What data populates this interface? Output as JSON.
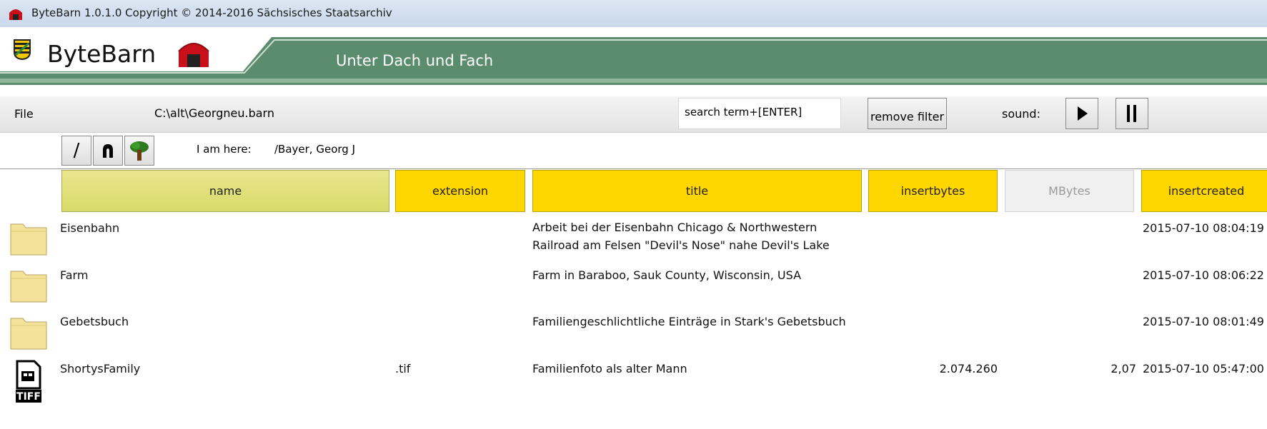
{
  "window": {
    "title": "ByteBarn 1.0.1.0    Copyright ©  2014-2016 Sächsisches Staatsarchiv"
  },
  "banner": {
    "brand": "ByteBarn",
    "motto": "Unter Dach und Fach",
    "colors": {
      "green": "#5b8c6e",
      "green_light": "#8fb59a",
      "barn_red": "#c8101a"
    },
    "icons": [
      "saxony-crest-icon",
      "barn-logo-icon"
    ]
  },
  "menubar": {
    "file_label": "File",
    "file_path": "C:\\alt\\Georgneu.barn",
    "search_placeholder": "search term+[ENTER]",
    "remove_filter_label": "remove filter",
    "sound_label": "sound:",
    "icons": [
      "play-icon",
      "pause-icon"
    ]
  },
  "nav": {
    "buttons": [
      {
        "label": "/",
        "icon": "root-slash-icon"
      },
      {
        "label": "",
        "icon": "up-arch-icon"
      },
      {
        "label": "",
        "icon": "tree-icon"
      }
    ],
    "iamhere_label": "I am here:",
    "current_path": "/Bayer, Georg J"
  },
  "table": {
    "columns": [
      "name",
      "extension",
      "title",
      "insertbytes",
      "MBytes",
      "insertcreated"
    ],
    "header_colors": {
      "active": "#ffd600",
      "name": "#e2e07c",
      "disabled": "#f0f0f0"
    },
    "rows": [
      {
        "icon": "folder-icon",
        "name": "Eisenbahn",
        "extension": "",
        "title": [
          "Arbeit bei der Eisenbahn Chicago & Northwestern",
          "Railroad am Felsen \"Devil's Nose\" nahe Devil's Lake"
        ],
        "insertbytes": "",
        "mbytes": "",
        "insertcreated": "2015-07-10 08:04:19"
      },
      {
        "icon": "folder-icon",
        "name": "Farm",
        "extension": "",
        "title": [
          "Farm in Baraboo, Sauk County, Wisconsin, USA",
          ""
        ],
        "insertbytes": "",
        "mbytes": "",
        "insertcreated": "2015-07-10 08:06:22"
      },
      {
        "icon": "folder-icon",
        "name": "Gebetsbuch",
        "extension": "",
        "title": [
          "Familiengeschlichtliche Einträge in Stark's Gebetsbuch",
          ""
        ],
        "insertbytes": "",
        "mbytes": "",
        "insertcreated": "2015-07-10 08:01:49"
      },
      {
        "icon": "tiff-file-icon",
        "name": "ShortysFamily",
        "extension": ".tif",
        "title": [
          "Familienfoto als alter Mann",
          ""
        ],
        "insertbytes": "2.074.260",
        "mbytes": "2,07",
        "insertcreated": "2015-07-10 05:47:00"
      }
    ]
  }
}
